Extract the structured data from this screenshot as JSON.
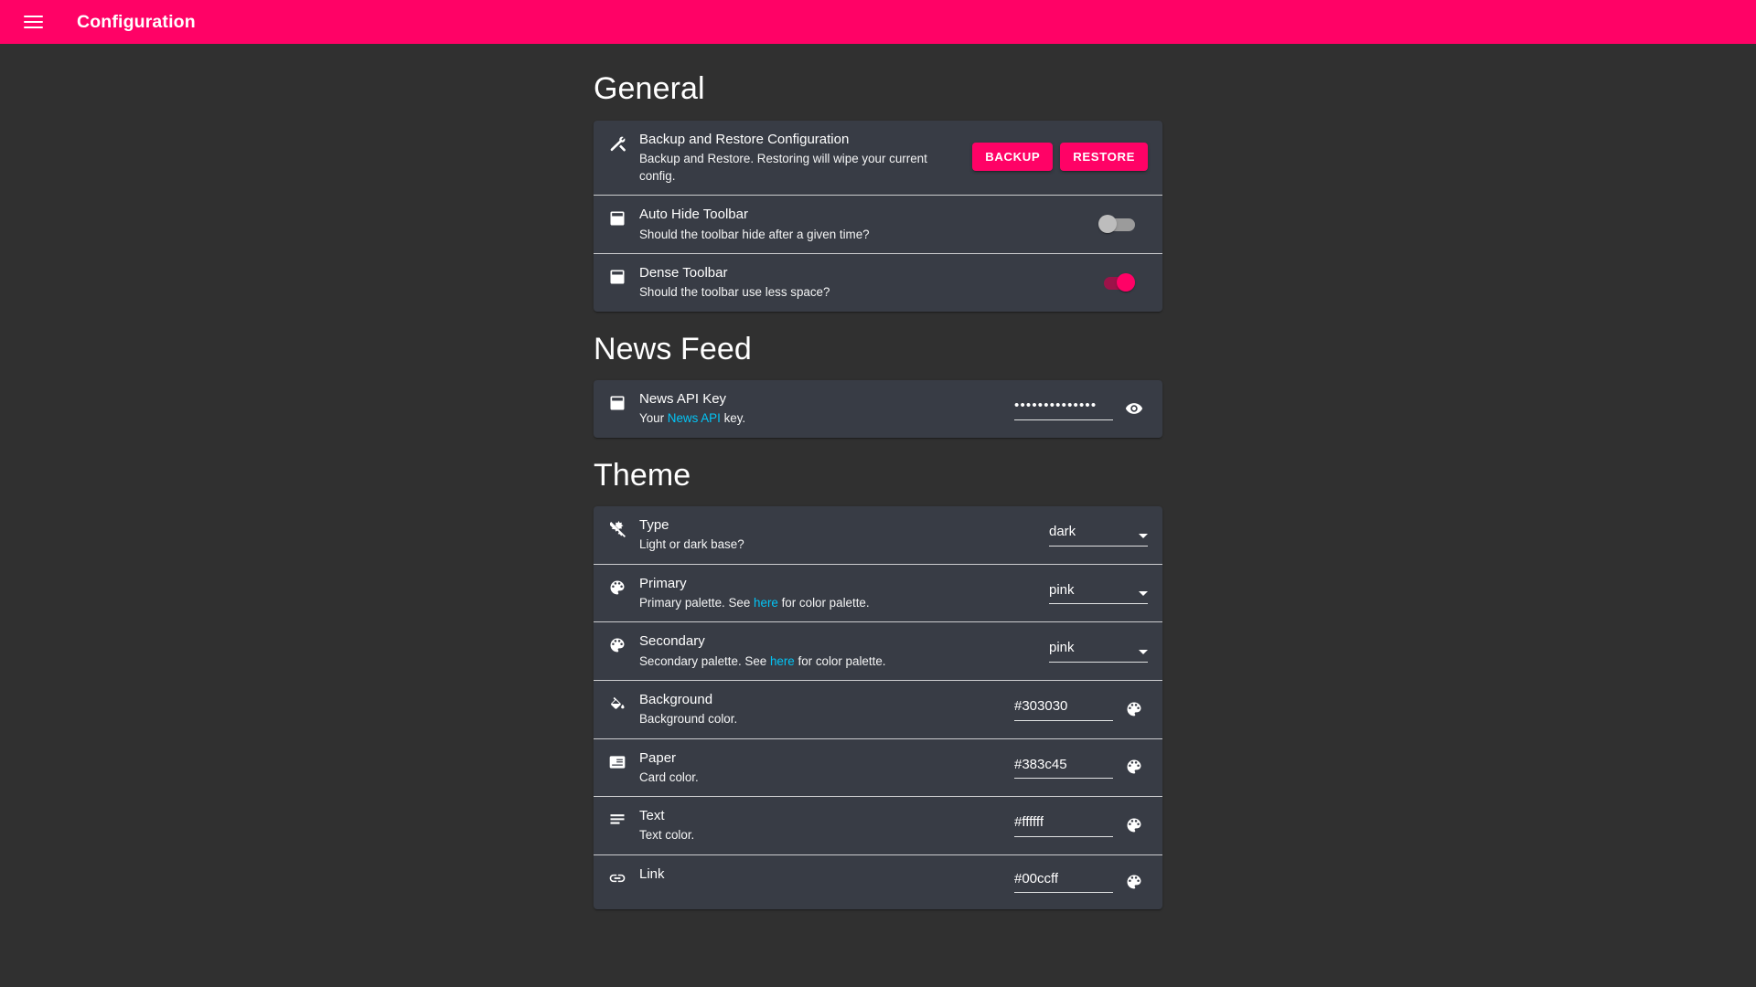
{
  "appbar": {
    "title": "Configuration",
    "menu_icon": "hamburger-menu-icon",
    "background": "#ff0266"
  },
  "theme_colors": {
    "page_background": "#303030",
    "card_background": "#383c45",
    "accent": "#ff0266",
    "text": "#ffffff",
    "link": "#00ccff"
  },
  "sections": [
    {
      "title": "General",
      "rows": [
        {
          "icon": "build-hammer-icon",
          "title": "Backup and Restore Configuration",
          "subtitle": "Backup and Restore. Restoring will wipe your current config.",
          "control": "buttons",
          "buttons": [
            {
              "label": "BACKUP",
              "name": "backup-button"
            },
            {
              "label": "RESTORE",
              "name": "restore-button"
            }
          ]
        },
        {
          "icon": "toolbar-icon",
          "title": "Auto Hide Toolbar",
          "subtitle": "Should the toolbar hide after a given time?",
          "control": "switch",
          "switch_on": false
        },
        {
          "icon": "toolbar-icon",
          "title": "Dense Toolbar",
          "subtitle": "Should the toolbar use less space?",
          "control": "switch",
          "switch_on": true
        }
      ]
    },
    {
      "title": "News Feed",
      "rows": [
        {
          "icon": "toolbar-icon",
          "title": "News API Key",
          "subtitle_prefix": "Your ",
          "subtitle_link": "News API",
          "subtitle_suffix": " key.",
          "control": "password",
          "value_masked": "••••••••••••••",
          "reveal_icon": "eye-icon"
        }
      ]
    },
    {
      "title": "Theme",
      "rows": [
        {
          "icon": "brightness-dark-icon",
          "title": "Type",
          "subtitle": "Light or dark base?",
          "control": "select",
          "value": "dark"
        },
        {
          "icon": "palette-icon",
          "title": "Primary",
          "subtitle_prefix": "Primary palette. See ",
          "subtitle_link": "here",
          "subtitle_suffix": " for color palette.",
          "control": "select",
          "value": "pink"
        },
        {
          "icon": "palette-icon",
          "title": "Secondary",
          "subtitle_prefix": "Secondary palette. See ",
          "subtitle_link": "here",
          "subtitle_suffix": " for color palette.",
          "control": "select",
          "value": "pink"
        },
        {
          "icon": "format-color-fill-icon",
          "title": "Background",
          "subtitle": "Background color.",
          "control": "color",
          "value": "#303030",
          "picker_icon": "palette-icon"
        },
        {
          "icon": "card-icon",
          "title": "Paper",
          "subtitle": "Card color.",
          "control": "color",
          "value": "#383c45",
          "picker_icon": "palette-icon"
        },
        {
          "icon": "text-lines-icon",
          "title": "Text",
          "subtitle": "Text color.",
          "control": "color",
          "value": "#ffffff",
          "picker_icon": "palette-icon"
        },
        {
          "icon": "link-icon",
          "title": "Link",
          "subtitle": "",
          "control": "color",
          "value": "#00ccff",
          "picker_icon": "palette-icon"
        }
      ]
    }
  ]
}
